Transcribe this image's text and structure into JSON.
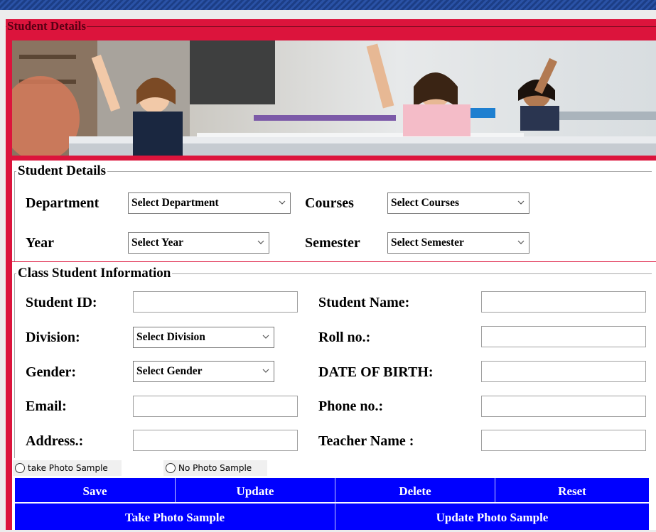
{
  "frame_title": "Student Details",
  "section_student": {
    "legend": "Student Details",
    "department_label": "Department",
    "department_value": "Select Department",
    "courses_label": "Courses",
    "courses_value": "Select Courses",
    "year_label": "Year",
    "year_value": "Select Year",
    "semester_label": "Semester",
    "semester_value": "Select Semester"
  },
  "section_class": {
    "legend": "Class Student Information",
    "student_id_label": "Student ID:",
    "student_name_label": "Student Name:",
    "division_label": "Division:",
    "division_value": "Select Division",
    "roll_label": "Roll no.:",
    "gender_label": "Gender:",
    "gender_value": "Select Gender",
    "dob_label": "DATE OF BIRTH:",
    "email_label": "Email:",
    "phone_label": "Phone no.:",
    "address_label": "Address.:",
    "teacher_label": "Teacher Name :"
  },
  "radios": {
    "take_sample": "take Photo Sample",
    "no_sample": "No Photo Sample"
  },
  "buttons": {
    "save": "Save",
    "update": "Update",
    "delete": "Delete",
    "reset": "Reset",
    "take_photo": "Take Photo Sample",
    "update_photo": "Update Photo Sample"
  },
  "colors": {
    "frame": "#dc143c",
    "button": "#0000ff",
    "topbar": "#1c3e86"
  }
}
